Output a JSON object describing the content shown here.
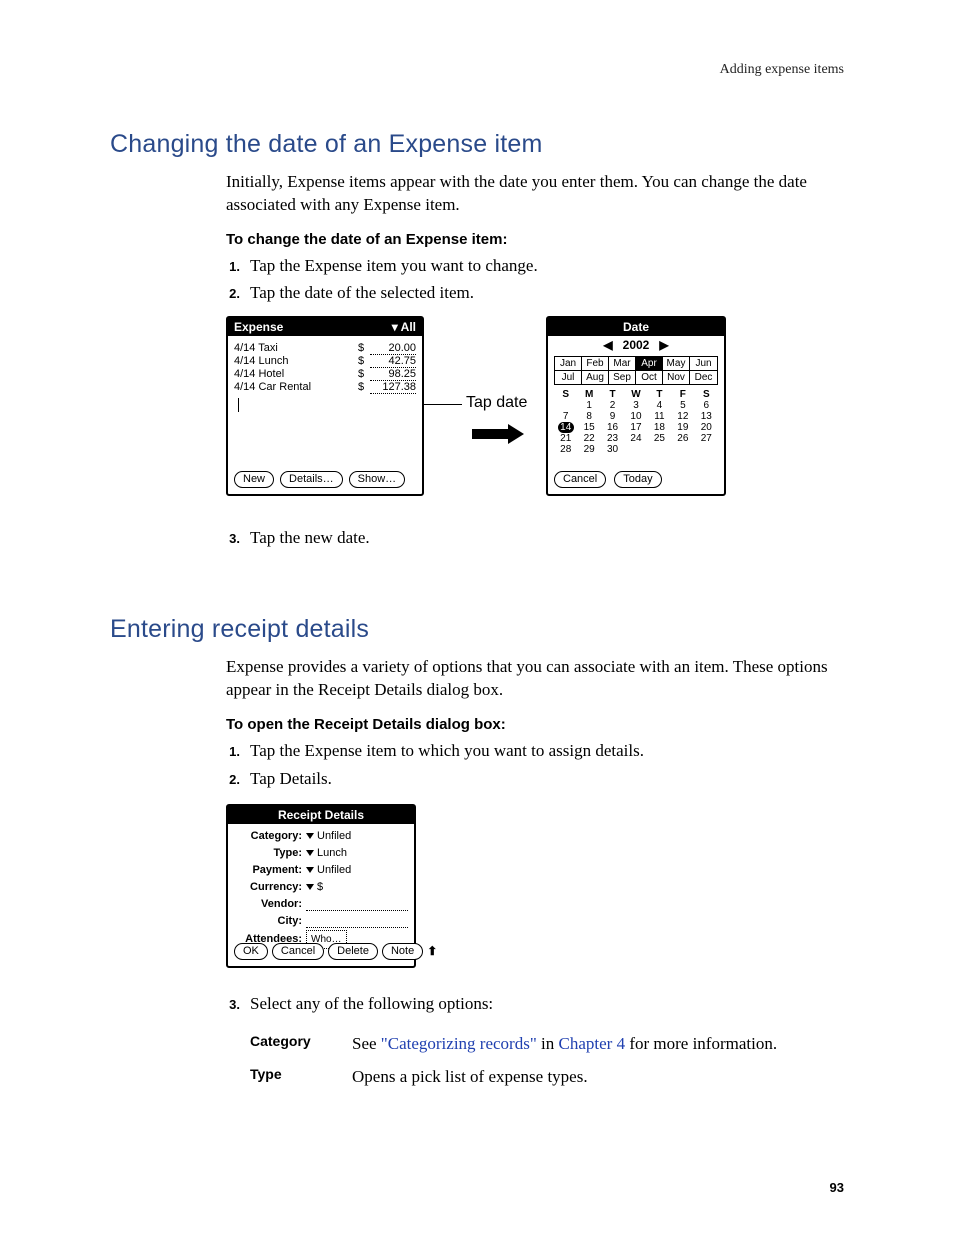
{
  "header": {
    "running_head": "Adding expense items"
  },
  "section1": {
    "heading": "Changing the date of an Expense item",
    "intro": "Initially, Expense items appear with the date you enter them. You can change the date associated with any Expense item.",
    "proc_head": "To change the date of an Expense item:",
    "steps_a": [
      "Tap the Expense item you want to change.",
      "Tap the date of the selected item."
    ],
    "steps_b": [
      "Tap the new date."
    ]
  },
  "fig_expense": {
    "title": "Expense",
    "category_label": "All",
    "rows": [
      {
        "desc": "4/14 Taxi",
        "cur": "$",
        "amt": "20.00"
      },
      {
        "desc": "4/14 Lunch",
        "cur": "$",
        "amt": "42.75"
      },
      {
        "desc": "4/14 Hotel",
        "cur": "$",
        "amt": "98.25"
      },
      {
        "desc": "4/14 Car Rental",
        "cur": "$",
        "amt": "127.38"
      }
    ],
    "buttons": {
      "new": "New",
      "details": "Details…",
      "show": "Show…"
    },
    "callout": "Tap date"
  },
  "fig_date": {
    "title": "Date",
    "year": "2002",
    "months_row1": [
      "Jan",
      "Feb",
      "Mar",
      "Apr",
      "May",
      "Jun"
    ],
    "months_row2": [
      "Jul",
      "Aug",
      "Sep",
      "Oct",
      "Nov",
      "Dec"
    ],
    "month_selected": "Apr",
    "dow": [
      "S",
      "M",
      "T",
      "W",
      "T",
      "F",
      "S"
    ],
    "weeks": [
      [
        "",
        "1",
        "2",
        "3",
        "4",
        "5",
        "6"
      ],
      [
        "7",
        "8",
        "9",
        "10",
        "11",
        "12",
        "13"
      ],
      [
        "14",
        "15",
        "16",
        "17",
        "18",
        "19",
        "20"
      ],
      [
        "21",
        "22",
        "23",
        "24",
        "25",
        "26",
        "27"
      ],
      [
        "28",
        "29",
        "30",
        "",
        "",
        "",
        ""
      ]
    ],
    "day_selected": "14",
    "buttons": {
      "cancel": "Cancel",
      "today": "Today"
    }
  },
  "section2": {
    "heading": "Entering receipt details",
    "intro": "Expense provides a variety of options that you can associate with an item. These options appear in the Receipt Details dialog box.",
    "proc_head": "To open the Receipt Details dialog box:",
    "steps_a": [
      "Tap the Expense item to which you want to assign details.",
      "Tap Details."
    ],
    "steps_b": [
      "Select any of the following options:"
    ]
  },
  "fig_receipt": {
    "title": "Receipt Details",
    "fields": {
      "category_label": "Category:",
      "category_value": "Unfiled",
      "type_label": "Type:",
      "type_value": "Lunch",
      "payment_label": "Payment:",
      "payment_value": "Unfiled",
      "currency_label": "Currency:",
      "currency_value": "$",
      "vendor_label": "Vendor:",
      "city_label": "City:",
      "attendees_label": "Attendees:",
      "attendees_button": "Who…"
    },
    "buttons": {
      "ok": "OK",
      "cancel": "Cancel",
      "delete": "Delete",
      "note": "Note"
    }
  },
  "options": {
    "category": {
      "term": "Category",
      "pre": "See ",
      "link1": "\"Categorizing records\"",
      "mid": " in ",
      "link2": "Chapter 4",
      "post": " for more information."
    },
    "type": {
      "term": "Type",
      "desc": "Opens a pick list of expense types."
    }
  },
  "page_number": "93"
}
